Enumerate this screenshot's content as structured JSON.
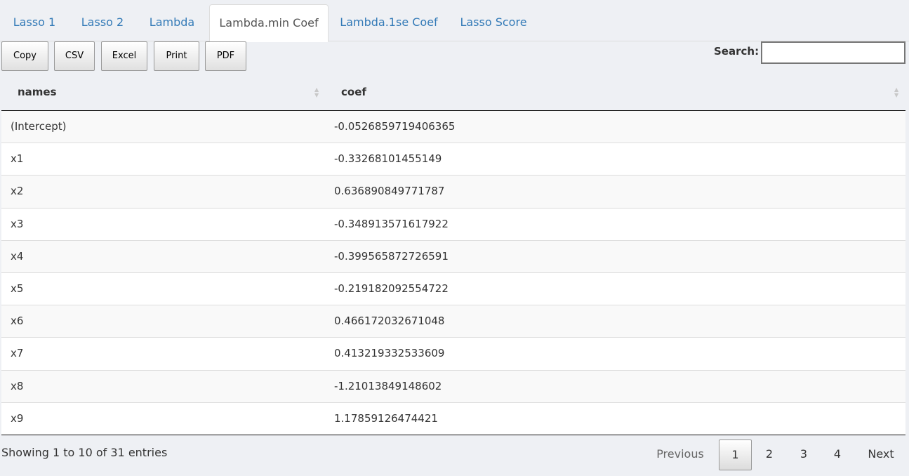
{
  "tabs": [
    {
      "label": "Lasso 1"
    },
    {
      "label": "Lasso 2"
    },
    {
      "label": "Lambda"
    },
    {
      "label": "Lambda.min Coef"
    },
    {
      "label": "Lambda.1se Coef"
    },
    {
      "label": "Lasso Score"
    }
  ],
  "toolbar": {
    "copy": "Copy",
    "csv": "CSV",
    "excel": "Excel",
    "print": "Print",
    "pdf": "PDF"
  },
  "search": {
    "label": "Search:",
    "value": ""
  },
  "table": {
    "columns": [
      "names",
      "coef"
    ],
    "rows": [
      [
        "(Intercept)",
        "-0.0526859719406365"
      ],
      [
        "x1",
        "-0.33268101455149"
      ],
      [
        "x2",
        "0.636890849771787"
      ],
      [
        "x3",
        "-0.348913571617922"
      ],
      [
        "x4",
        "-0.399565872726591"
      ],
      [
        "x5",
        "-0.219182092554722"
      ],
      [
        "x6",
        "0.466172032671048"
      ],
      [
        "x7",
        "0.413219332533609"
      ],
      [
        "x8",
        "-1.21013849148602"
      ],
      [
        "x9",
        "1.17859126474421"
      ]
    ]
  },
  "info": "Showing 1 to 10 of 31 entries",
  "pagination": {
    "previous": "Previous",
    "pages": [
      "1",
      "2",
      "3",
      "4"
    ],
    "next": "Next",
    "current": "1"
  }
}
